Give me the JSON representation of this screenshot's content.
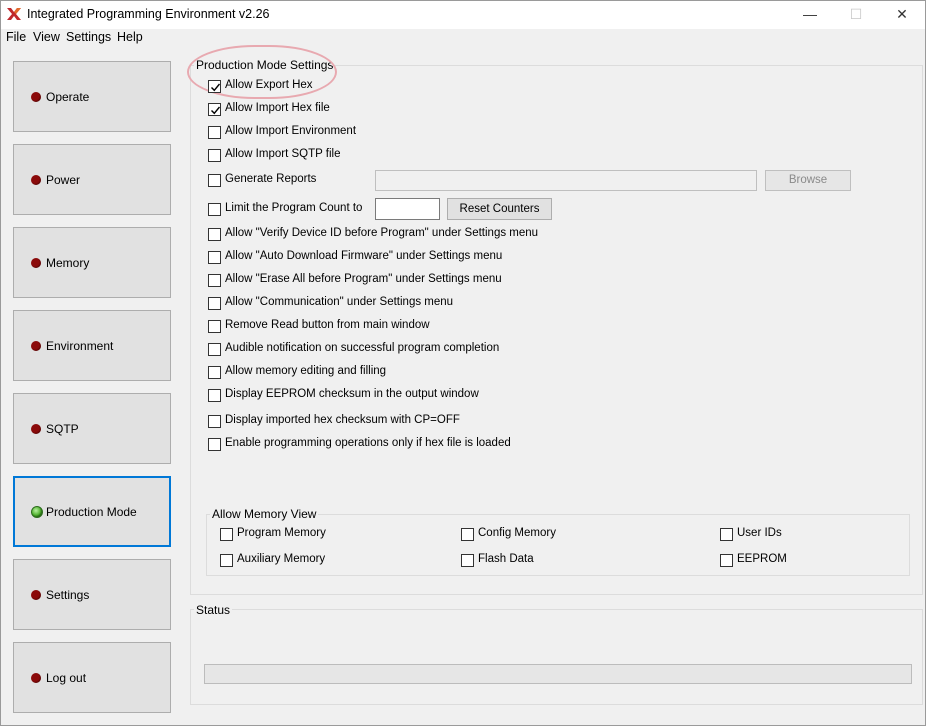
{
  "window": {
    "title": "Integrated Programming Environment v2.26",
    "controls": {
      "minimize": "—",
      "maximize": "☐",
      "close": "✕"
    }
  },
  "menu": [
    "File",
    "View",
    "Settings",
    "Help"
  ],
  "sidebar": {
    "items": [
      {
        "label": "Operate",
        "status": "red"
      },
      {
        "label": "Power",
        "status": "red"
      },
      {
        "label": "Memory",
        "status": "red"
      },
      {
        "label": "Environment",
        "status": "red"
      },
      {
        "label": "SQTP",
        "status": "red"
      },
      {
        "label": "Production Mode",
        "status": "green",
        "active": true
      },
      {
        "label": "Settings",
        "status": "red"
      },
      {
        "label": "Log out",
        "status": "red"
      }
    ]
  },
  "production_settings": {
    "title": "Production Mode Settings",
    "options": [
      {
        "label": "Allow Export Hex",
        "checked": true
      },
      {
        "label": "Allow Import Hex file",
        "checked": true
      },
      {
        "label": "Allow Import Environment",
        "checked": false
      },
      {
        "label": "Allow Import SQTP file",
        "checked": false
      },
      {
        "label": "Generate Reports",
        "checked": false
      },
      {
        "label": "Limit the Program Count to",
        "checked": false
      },
      {
        "label": "Allow \"Verify Device ID before Program\" under Settings menu",
        "checked": false
      },
      {
        "label": "Allow \"Auto Download Firmware\" under Settings menu",
        "checked": false
      },
      {
        "label": "Allow \"Erase All before Program\" under Settings menu",
        "checked": false
      },
      {
        "label": "Allow \"Communication\" under Settings menu",
        "checked": false
      },
      {
        "label": "Remove Read button from main window",
        "checked": false
      },
      {
        "label": "Audible notification on successful program completion",
        "checked": false
      },
      {
        "label": "Allow memory editing and filling",
        "checked": false
      },
      {
        "label": "Display EEPROM checksum in the output window",
        "checked": false
      },
      {
        "label": "Display imported hex checksum with CP=OFF",
        "checked": false
      },
      {
        "label": "Enable programming operations only if hex file is loaded",
        "checked": false
      }
    ],
    "reports_path_value": "",
    "browse_label": "Browse",
    "program_count_value": "",
    "reset_counters_label": "Reset Counters"
  },
  "memory_view": {
    "title": "Allow Memory View",
    "options": [
      {
        "label": "Program Memory",
        "checked": false
      },
      {
        "label": "Config Memory",
        "checked": false
      },
      {
        "label": "User IDs",
        "checked": false
      },
      {
        "label": "Auxiliary Memory",
        "checked": false
      },
      {
        "label": "Flash Data",
        "checked": false
      },
      {
        "label": "EEPROM",
        "checked": false
      }
    ]
  },
  "status": {
    "title": "Status",
    "progress": 0
  },
  "colors": {
    "led_red": "#8b0a0a",
    "led_green": "#4caf2a",
    "active_border": "#0078d7",
    "highlight": "#e8a9b0"
  }
}
